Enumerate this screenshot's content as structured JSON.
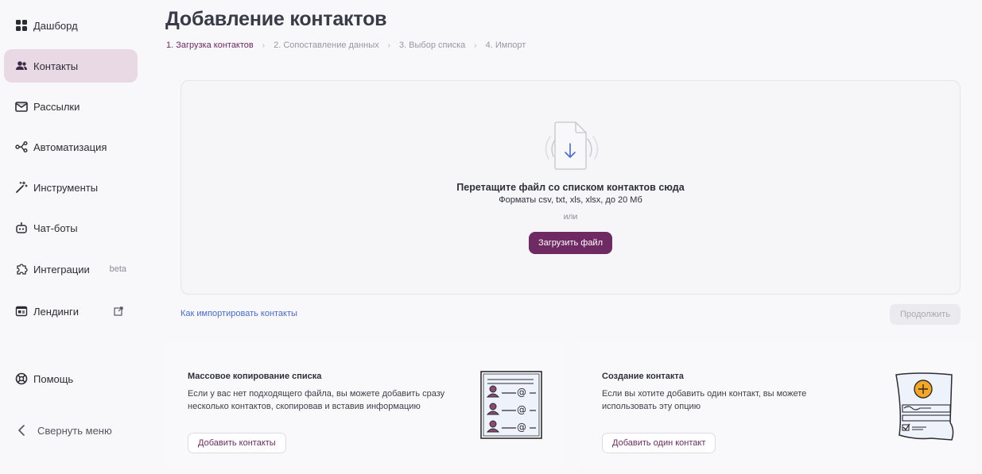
{
  "sidebar": {
    "items": [
      {
        "label": "Дашборд",
        "icon": "dashboard-icon"
      },
      {
        "label": "Контакты",
        "icon": "contacts-icon",
        "active": true
      },
      {
        "label": "Рассылки",
        "icon": "mail-icon"
      },
      {
        "label": "Автоматизация",
        "icon": "automation-icon"
      },
      {
        "label": "Инструменты",
        "icon": "magic-wand-icon"
      },
      {
        "label": "Чат-боты",
        "icon": "bot-icon"
      },
      {
        "label": "Интеграции",
        "icon": "puzzle-icon",
        "tag": "beta"
      },
      {
        "label": "Лендинги",
        "icon": "landing-icon",
        "external": true
      },
      {
        "label": "Помощь",
        "icon": "help-icon"
      }
    ],
    "collapse_label": "Свернуть меню"
  },
  "header": {
    "title": "Добавление контактов",
    "steps": [
      "1. Загрузка контактов",
      "2. Сопоставление данных",
      "3. Выбор списка",
      "4. Импорт"
    ],
    "active_step": 0
  },
  "dropzone": {
    "title": "Перетащите файл со списком контактов сюда",
    "formats": "Форматы csv, txt, xls, xlsx, до 20 Мб",
    "or": "или",
    "upload_label": "Загрузить файл"
  },
  "footer": {
    "howto_link": "Как импортировать контакты",
    "continue_label": "Продолжить"
  },
  "cards": [
    {
      "title": "Массовое копирование списка",
      "description": "Если у вас нет подходящего файла, вы можете добавить сразу несколько контактов, скопировав и вставив информацию",
      "button_label": "Добавить контакты"
    },
    {
      "title": "Создание контакта",
      "description": "Если вы хотите добавить один контакт, вы можете использовать эту опцию",
      "button_label": "Добавить один контакт"
    }
  ],
  "colors": {
    "accent": "#6f2a63",
    "active_nav_bg": "#e8d9e5",
    "link": "#4a6ad1",
    "orange_accent": "#f5a623"
  }
}
